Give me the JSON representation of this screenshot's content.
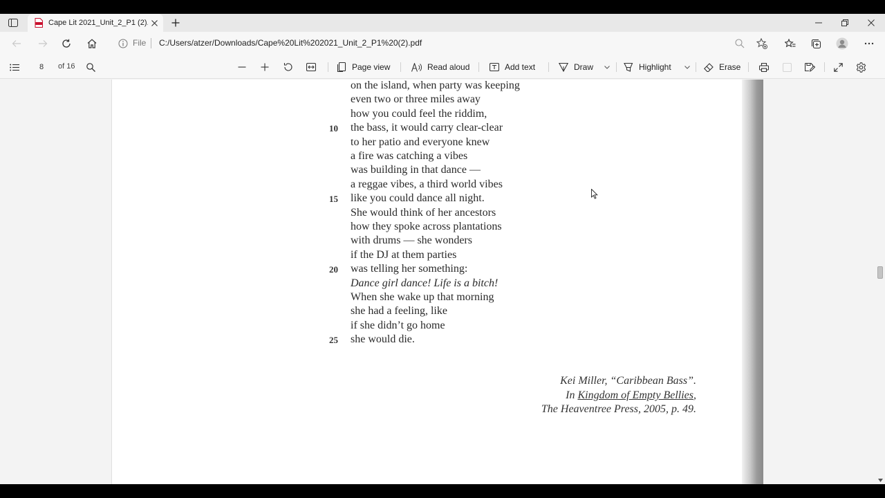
{
  "tab": {
    "title": "Cape Lit 2021_Unit_2_P1 (2).pdf"
  },
  "address": {
    "file_label": "File",
    "url": "C:/Users/atzer/Downloads/Cape%20Lit%202021_Unit_2_P1%20(2).pdf"
  },
  "toolbar": {
    "page_current": "8",
    "page_total": "of 16",
    "page_view_label": "Page view",
    "read_aloud_label": "Read aloud",
    "add_text_label": "Add text",
    "draw_label": "Draw",
    "highlight_label": "Highlight",
    "erase_label": "Erase"
  },
  "poem": {
    "lines": [
      "on the island, when party was keeping",
      "even two or three miles away",
      "how you could feel the riddim,",
      "the bass, it would carry clear-clear",
      "to her patio and everyone knew",
      "a fire was catching a vibes",
      "was building in that dance —",
      "a reggae vibes, a third world vibes",
      "like you could dance all night.",
      "She would think of her ancestors",
      "how they spoke across plantations",
      "with drums — she wonders",
      "if the DJ at them parties",
      "was telling her something:",
      "Dance girl dance! Life is a bitch!",
      "When she wake up that morning",
      "she had a feeling, like",
      "if she didn’t go home",
      "she would die."
    ],
    "line_numbers": [
      "10",
      "15",
      "20",
      "25"
    ]
  },
  "citation": {
    "line1": "Kei Miller, “Caribbean Bass”.",
    "line2_prefix": "In ",
    "line2_book": "Kingdom of Empty Bellies",
    "line2_suffix": ",",
    "line3": "The Heaventree Press, 2005, p. 49."
  },
  "colors": {
    "pdf_icon": "#c8102e",
    "page_bg": "#ffffff",
    "chrome_bg": "#f7f7f7"
  }
}
